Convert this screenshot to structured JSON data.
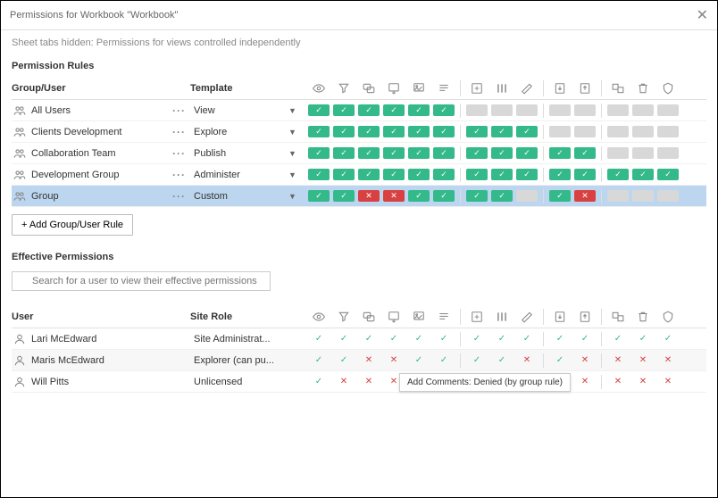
{
  "dialog": {
    "title": "Permissions for Workbook \"Workbook\"",
    "subtitle": "Sheet tabs hidden: Permissions for views controlled independently"
  },
  "rules": {
    "heading": "Permission Rules",
    "col_group": "Group/User",
    "col_template": "Template",
    "add_button": "+ Add Group/User Rule",
    "header_icons": [
      "view",
      "filter",
      "comment",
      "download-image",
      "download-summary",
      "download-data",
      "__sep",
      "share",
      "web-edit",
      "full-data",
      "__sep",
      "download-wb",
      "overwrite",
      "__sep",
      "move",
      "delete",
      "set-perms"
    ],
    "items": [
      {
        "name": "All Users",
        "template": "View",
        "perms": [
          "allow",
          "allow",
          "allow",
          "allow",
          "allow",
          "allow",
          "__sep",
          "none",
          "none",
          "none",
          "__sep",
          "none",
          "none",
          "__sep",
          "none",
          "none",
          "none"
        ]
      },
      {
        "name": "Clients Development",
        "template": "Explore",
        "perms": [
          "allow",
          "allow",
          "allow",
          "allow",
          "allow",
          "allow",
          "__sep",
          "allow",
          "allow",
          "allow",
          "__sep",
          "none",
          "none",
          "__sep",
          "none",
          "none",
          "none"
        ]
      },
      {
        "name": "Collaboration Team",
        "template": "Publish",
        "perms": [
          "allow",
          "allow",
          "allow",
          "allow",
          "allow",
          "allow",
          "__sep",
          "allow",
          "allow",
          "allow",
          "__sep",
          "allow",
          "allow",
          "__sep",
          "none",
          "none",
          "none"
        ]
      },
      {
        "name": "Development Group",
        "template": "Administer",
        "perms": [
          "allow",
          "allow",
          "allow",
          "allow",
          "allow",
          "allow",
          "__sep",
          "allow",
          "allow",
          "allow",
          "__sep",
          "allow",
          "allow",
          "__sep",
          "allow",
          "allow",
          "allow"
        ]
      },
      {
        "name": "Group",
        "template": "Custom",
        "selected": true,
        "perms": [
          "allow",
          "allow",
          "deny",
          "deny",
          "allow",
          "allow",
          "__sep",
          "allow",
          "allow",
          "none",
          "__sep",
          "allow",
          "deny",
          "__sep",
          "none",
          "none",
          "none"
        ]
      }
    ]
  },
  "effective": {
    "heading": "Effective Permissions",
    "search_placeholder": "Search for a user to view their effective permissions",
    "col_user": "User",
    "col_role": "Site Role",
    "tooltip": "Add Comments: Denied (by group rule)",
    "users": [
      {
        "name": "Lari McEdward",
        "role": "Site Administrat...",
        "perms": [
          "allow",
          "allow",
          "allow",
          "allow",
          "allow",
          "allow",
          "__sep",
          "allow",
          "allow",
          "allow",
          "__sep",
          "allow",
          "allow",
          "__sep",
          "allow",
          "allow",
          "allow"
        ]
      },
      {
        "name": "Maris McEdward",
        "role": "Explorer (can pu...",
        "alt": true,
        "perms": [
          "allow",
          "allow",
          "deny",
          "deny",
          "allow",
          "allow",
          "__sep",
          "allow",
          "allow",
          "deny",
          "__sep",
          "allow",
          "deny",
          "__sep",
          "deny",
          "deny",
          "deny"
        ]
      },
      {
        "name": "Will Pitts",
        "role": "Unlicensed",
        "tooltip_row": true,
        "perms": [
          "allow",
          "deny",
          "deny",
          "deny",
          "",
          "",
          "__sep",
          "",
          "",
          "",
          "__sep",
          "allow",
          "deny",
          "__sep",
          "deny",
          "deny",
          "deny"
        ]
      }
    ]
  }
}
